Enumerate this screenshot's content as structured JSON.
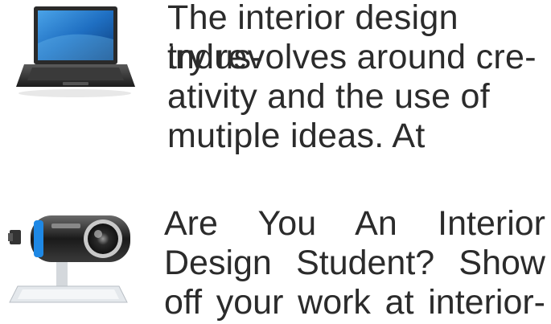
{
  "articles": [
    {
      "icon": "laptop-icon",
      "lines": [
        "The interior design indus-",
        "try revolves around cre-",
        "ativity and the use of",
        "mutiple ideas. At"
      ]
    },
    {
      "icon": "webcam-icon",
      "lines": [
        "Are You An Interior",
        "Design Student? Show",
        "off your work at interior-"
      ]
    }
  ],
  "colors": {
    "text": "#2b2b2b",
    "background": "#ffffff",
    "webcam_accent": "#1e88e5"
  }
}
